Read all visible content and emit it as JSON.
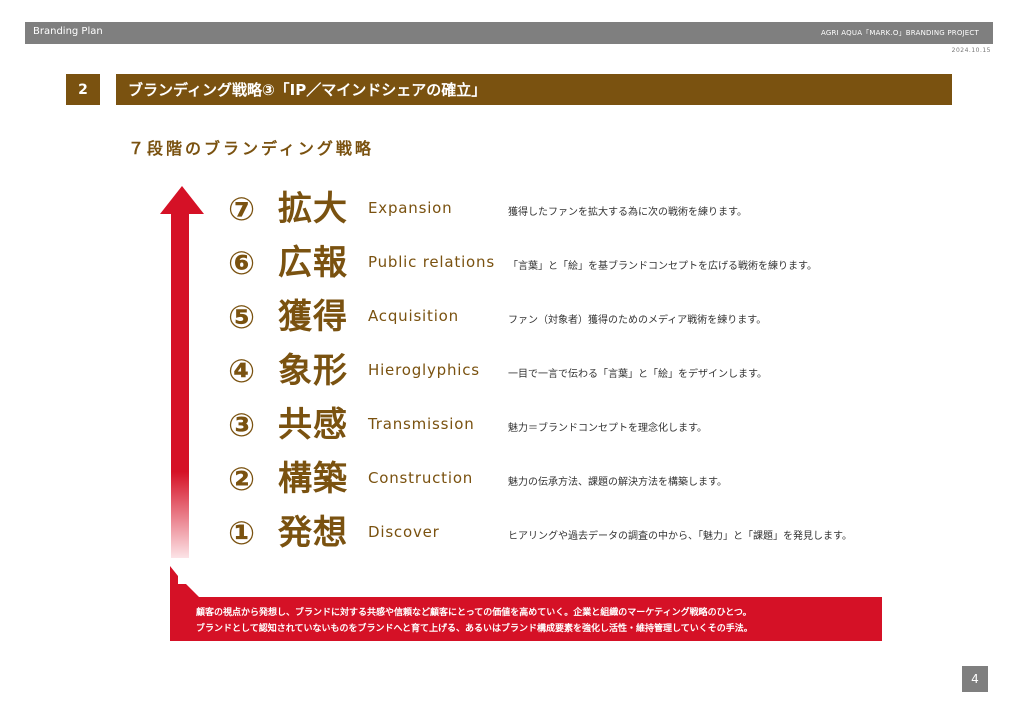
{
  "header": {
    "left_label": "Branding Plan",
    "right_label": "AGRI AQUA「MARK.O」BRANDING PROJECT",
    "date": "2024.10.15"
  },
  "section": {
    "number": "2",
    "title": "ブランディング戦略③「IP／マインドシェアの確立」",
    "subtitle": "７段階のブランディング戦略"
  },
  "steps": [
    {
      "num": "⑦",
      "kanji": "拡大",
      "en": "Expansion",
      "desc": "獲得したファンを拡大する為に次の戦術を練ります。"
    },
    {
      "num": "⑥",
      "kanji": "広報",
      "en": "Public relations",
      "desc": "「言葉」と「絵」を基ブランドコンセプトを広げる戦術を練ります。"
    },
    {
      "num": "⑤",
      "kanji": "獲得",
      "en": "Acquisition",
      "desc": "ファン（対象者）獲得のためのメディア戦術を練ります。"
    },
    {
      "num": "④",
      "kanji": "象形",
      "en": "Hieroglyphics",
      "desc": "一目で一言で伝わる「言葉」と「絵」をデザインします。"
    },
    {
      "num": "③",
      "kanji": "共感",
      "en": "Transmission",
      "desc": "魅力＝ブランドコンセプトを理念化します。"
    },
    {
      "num": "②",
      "kanji": "構築",
      "en": "Construction",
      "desc": "魅力の伝承方法、課題の解決方法を構築します。"
    },
    {
      "num": "①",
      "kanji": "発想",
      "en": "Discover",
      "desc": "ヒアリングや過去データの調査の中から、「魅力」と「課題」を発見します。"
    }
  ],
  "note": {
    "line1": "顧客の視点から発想し、ブランドに対する共感や信頼など顧客にとっての価値を高めていく。企業と組織のマーケティング戦略のひとつ。",
    "line2": "ブランドとして認知されていないものをブランドへと育て上げる、あるいはブランド構成要素を強化し活性・維持管理していくその手法。"
  },
  "page_number": "4",
  "colors": {
    "brown": "#7a5210",
    "red": "#d51126",
    "gray": "#7f7f7f"
  }
}
